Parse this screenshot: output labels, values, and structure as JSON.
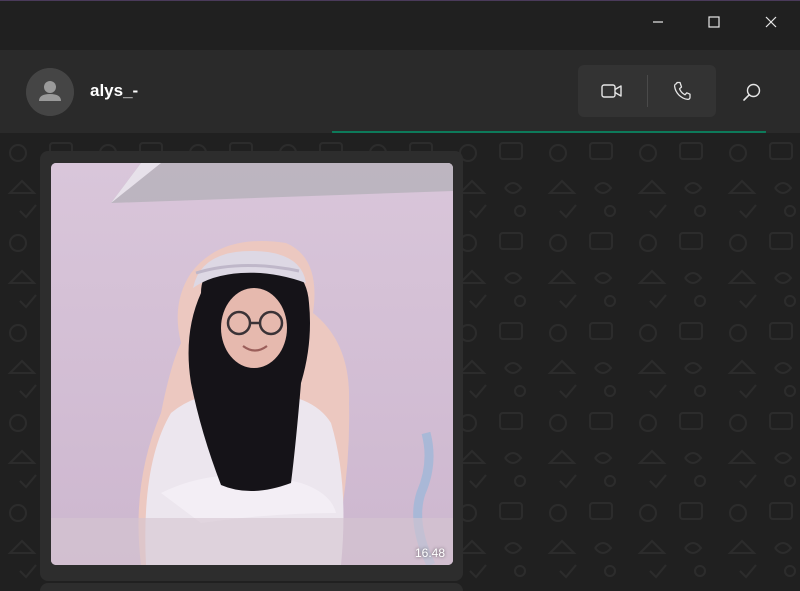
{
  "window": {
    "controls": {
      "minimize_icon": "minimize-icon",
      "maximize_icon": "maximize-icon",
      "close_icon": "close-icon"
    }
  },
  "header": {
    "contact_name": "alys_-",
    "avatar_icon": "default-avatar-icon",
    "video_call_icon": "video-camera-icon",
    "voice_call_icon": "phone-icon",
    "search_icon": "search-icon"
  },
  "messages": [
    {
      "type": "image",
      "description_icon": "photo",
      "time": "16.48"
    }
  ],
  "colors": {
    "accent": "#0d7a5a",
    "header_bg": "#2a2a2a",
    "chat_bg": "#202020",
    "bubble_bg": "#2d2d2d"
  }
}
